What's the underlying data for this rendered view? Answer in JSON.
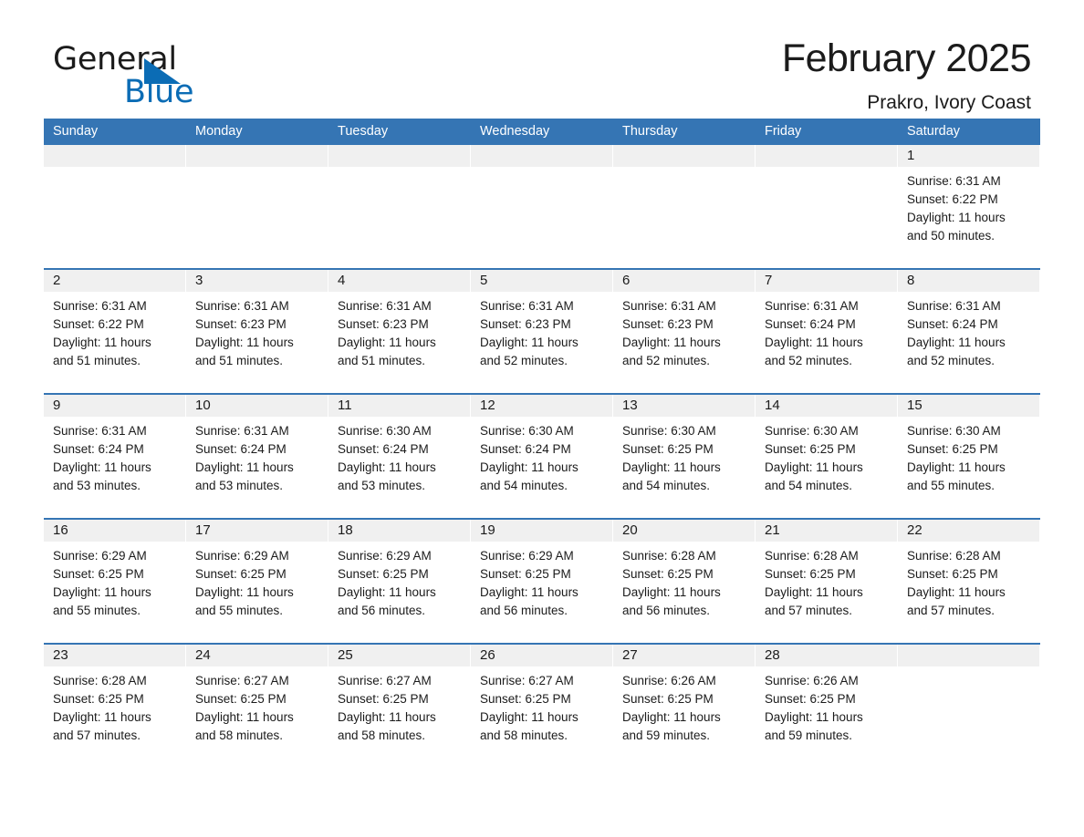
{
  "brand": {
    "name_part1": "General",
    "name_part2": "Blue"
  },
  "header": {
    "title": "February 2025",
    "location": "Prakro, Ivory Coast"
  },
  "colors": {
    "header_blue": "#3575b4",
    "brand_blue": "#0b6cb5",
    "daynum_band": "#f0f0f0",
    "text": "#1b1b1b"
  },
  "weekdays": [
    "Sunday",
    "Monday",
    "Tuesday",
    "Wednesday",
    "Thursday",
    "Friday",
    "Saturday"
  ],
  "weeks": [
    [
      {
        "day": "",
        "sunrise": "",
        "sunset": "",
        "daylight_line1": "",
        "daylight_line2": ""
      },
      {
        "day": "",
        "sunrise": "",
        "sunset": "",
        "daylight_line1": "",
        "daylight_line2": ""
      },
      {
        "day": "",
        "sunrise": "",
        "sunset": "",
        "daylight_line1": "",
        "daylight_line2": ""
      },
      {
        "day": "",
        "sunrise": "",
        "sunset": "",
        "daylight_line1": "",
        "daylight_line2": ""
      },
      {
        "day": "",
        "sunrise": "",
        "sunset": "",
        "daylight_line1": "",
        "daylight_line2": ""
      },
      {
        "day": "",
        "sunrise": "",
        "sunset": "",
        "daylight_line1": "",
        "daylight_line2": ""
      },
      {
        "day": "1",
        "sunrise": "Sunrise: 6:31 AM",
        "sunset": "Sunset: 6:22 PM",
        "daylight_line1": "Daylight: 11 hours",
        "daylight_line2": "and 50 minutes."
      }
    ],
    [
      {
        "day": "2",
        "sunrise": "Sunrise: 6:31 AM",
        "sunset": "Sunset: 6:22 PM",
        "daylight_line1": "Daylight: 11 hours",
        "daylight_line2": "and 51 minutes."
      },
      {
        "day": "3",
        "sunrise": "Sunrise: 6:31 AM",
        "sunset": "Sunset: 6:23 PM",
        "daylight_line1": "Daylight: 11 hours",
        "daylight_line2": "and 51 minutes."
      },
      {
        "day": "4",
        "sunrise": "Sunrise: 6:31 AM",
        "sunset": "Sunset: 6:23 PM",
        "daylight_line1": "Daylight: 11 hours",
        "daylight_line2": "and 51 minutes."
      },
      {
        "day": "5",
        "sunrise": "Sunrise: 6:31 AM",
        "sunset": "Sunset: 6:23 PM",
        "daylight_line1": "Daylight: 11 hours",
        "daylight_line2": "and 52 minutes."
      },
      {
        "day": "6",
        "sunrise": "Sunrise: 6:31 AM",
        "sunset": "Sunset: 6:23 PM",
        "daylight_line1": "Daylight: 11 hours",
        "daylight_line2": "and 52 minutes."
      },
      {
        "day": "7",
        "sunrise": "Sunrise: 6:31 AM",
        "sunset": "Sunset: 6:24 PM",
        "daylight_line1": "Daylight: 11 hours",
        "daylight_line2": "and 52 minutes."
      },
      {
        "day": "8",
        "sunrise": "Sunrise: 6:31 AM",
        "sunset": "Sunset: 6:24 PM",
        "daylight_line1": "Daylight: 11 hours",
        "daylight_line2": "and 52 minutes."
      }
    ],
    [
      {
        "day": "9",
        "sunrise": "Sunrise: 6:31 AM",
        "sunset": "Sunset: 6:24 PM",
        "daylight_line1": "Daylight: 11 hours",
        "daylight_line2": "and 53 minutes."
      },
      {
        "day": "10",
        "sunrise": "Sunrise: 6:31 AM",
        "sunset": "Sunset: 6:24 PM",
        "daylight_line1": "Daylight: 11 hours",
        "daylight_line2": "and 53 minutes."
      },
      {
        "day": "11",
        "sunrise": "Sunrise: 6:30 AM",
        "sunset": "Sunset: 6:24 PM",
        "daylight_line1": "Daylight: 11 hours",
        "daylight_line2": "and 53 minutes."
      },
      {
        "day": "12",
        "sunrise": "Sunrise: 6:30 AM",
        "sunset": "Sunset: 6:24 PM",
        "daylight_line1": "Daylight: 11 hours",
        "daylight_line2": "and 54 minutes."
      },
      {
        "day": "13",
        "sunrise": "Sunrise: 6:30 AM",
        "sunset": "Sunset: 6:25 PM",
        "daylight_line1": "Daylight: 11 hours",
        "daylight_line2": "and 54 minutes."
      },
      {
        "day": "14",
        "sunrise": "Sunrise: 6:30 AM",
        "sunset": "Sunset: 6:25 PM",
        "daylight_line1": "Daylight: 11 hours",
        "daylight_line2": "and 54 minutes."
      },
      {
        "day": "15",
        "sunrise": "Sunrise: 6:30 AM",
        "sunset": "Sunset: 6:25 PM",
        "daylight_line1": "Daylight: 11 hours",
        "daylight_line2": "and 55 minutes."
      }
    ],
    [
      {
        "day": "16",
        "sunrise": "Sunrise: 6:29 AM",
        "sunset": "Sunset: 6:25 PM",
        "daylight_line1": "Daylight: 11 hours",
        "daylight_line2": "and 55 minutes."
      },
      {
        "day": "17",
        "sunrise": "Sunrise: 6:29 AM",
        "sunset": "Sunset: 6:25 PM",
        "daylight_line1": "Daylight: 11 hours",
        "daylight_line2": "and 55 minutes."
      },
      {
        "day": "18",
        "sunrise": "Sunrise: 6:29 AM",
        "sunset": "Sunset: 6:25 PM",
        "daylight_line1": "Daylight: 11 hours",
        "daylight_line2": "and 56 minutes."
      },
      {
        "day": "19",
        "sunrise": "Sunrise: 6:29 AM",
        "sunset": "Sunset: 6:25 PM",
        "daylight_line1": "Daylight: 11 hours",
        "daylight_line2": "and 56 minutes."
      },
      {
        "day": "20",
        "sunrise": "Sunrise: 6:28 AM",
        "sunset": "Sunset: 6:25 PM",
        "daylight_line1": "Daylight: 11 hours",
        "daylight_line2": "and 56 minutes."
      },
      {
        "day": "21",
        "sunrise": "Sunrise: 6:28 AM",
        "sunset": "Sunset: 6:25 PM",
        "daylight_line1": "Daylight: 11 hours",
        "daylight_line2": "and 57 minutes."
      },
      {
        "day": "22",
        "sunrise": "Sunrise: 6:28 AM",
        "sunset": "Sunset: 6:25 PM",
        "daylight_line1": "Daylight: 11 hours",
        "daylight_line2": "and 57 minutes."
      }
    ],
    [
      {
        "day": "23",
        "sunrise": "Sunrise: 6:28 AM",
        "sunset": "Sunset: 6:25 PM",
        "daylight_line1": "Daylight: 11 hours",
        "daylight_line2": "and 57 minutes."
      },
      {
        "day": "24",
        "sunrise": "Sunrise: 6:27 AM",
        "sunset": "Sunset: 6:25 PM",
        "daylight_line1": "Daylight: 11 hours",
        "daylight_line2": "and 58 minutes."
      },
      {
        "day": "25",
        "sunrise": "Sunrise: 6:27 AM",
        "sunset": "Sunset: 6:25 PM",
        "daylight_line1": "Daylight: 11 hours",
        "daylight_line2": "and 58 minutes."
      },
      {
        "day": "26",
        "sunrise": "Sunrise: 6:27 AM",
        "sunset": "Sunset: 6:25 PM",
        "daylight_line1": "Daylight: 11 hours",
        "daylight_line2": "and 58 minutes."
      },
      {
        "day": "27",
        "sunrise": "Sunrise: 6:26 AM",
        "sunset": "Sunset: 6:25 PM",
        "daylight_line1": "Daylight: 11 hours",
        "daylight_line2": "and 59 minutes."
      },
      {
        "day": "28",
        "sunrise": "Sunrise: 6:26 AM",
        "sunset": "Sunset: 6:25 PM",
        "daylight_line1": "Daylight: 11 hours",
        "daylight_line2": "and 59 minutes."
      },
      {
        "day": "",
        "sunrise": "",
        "sunset": "",
        "daylight_line1": "",
        "daylight_line2": ""
      }
    ]
  ]
}
